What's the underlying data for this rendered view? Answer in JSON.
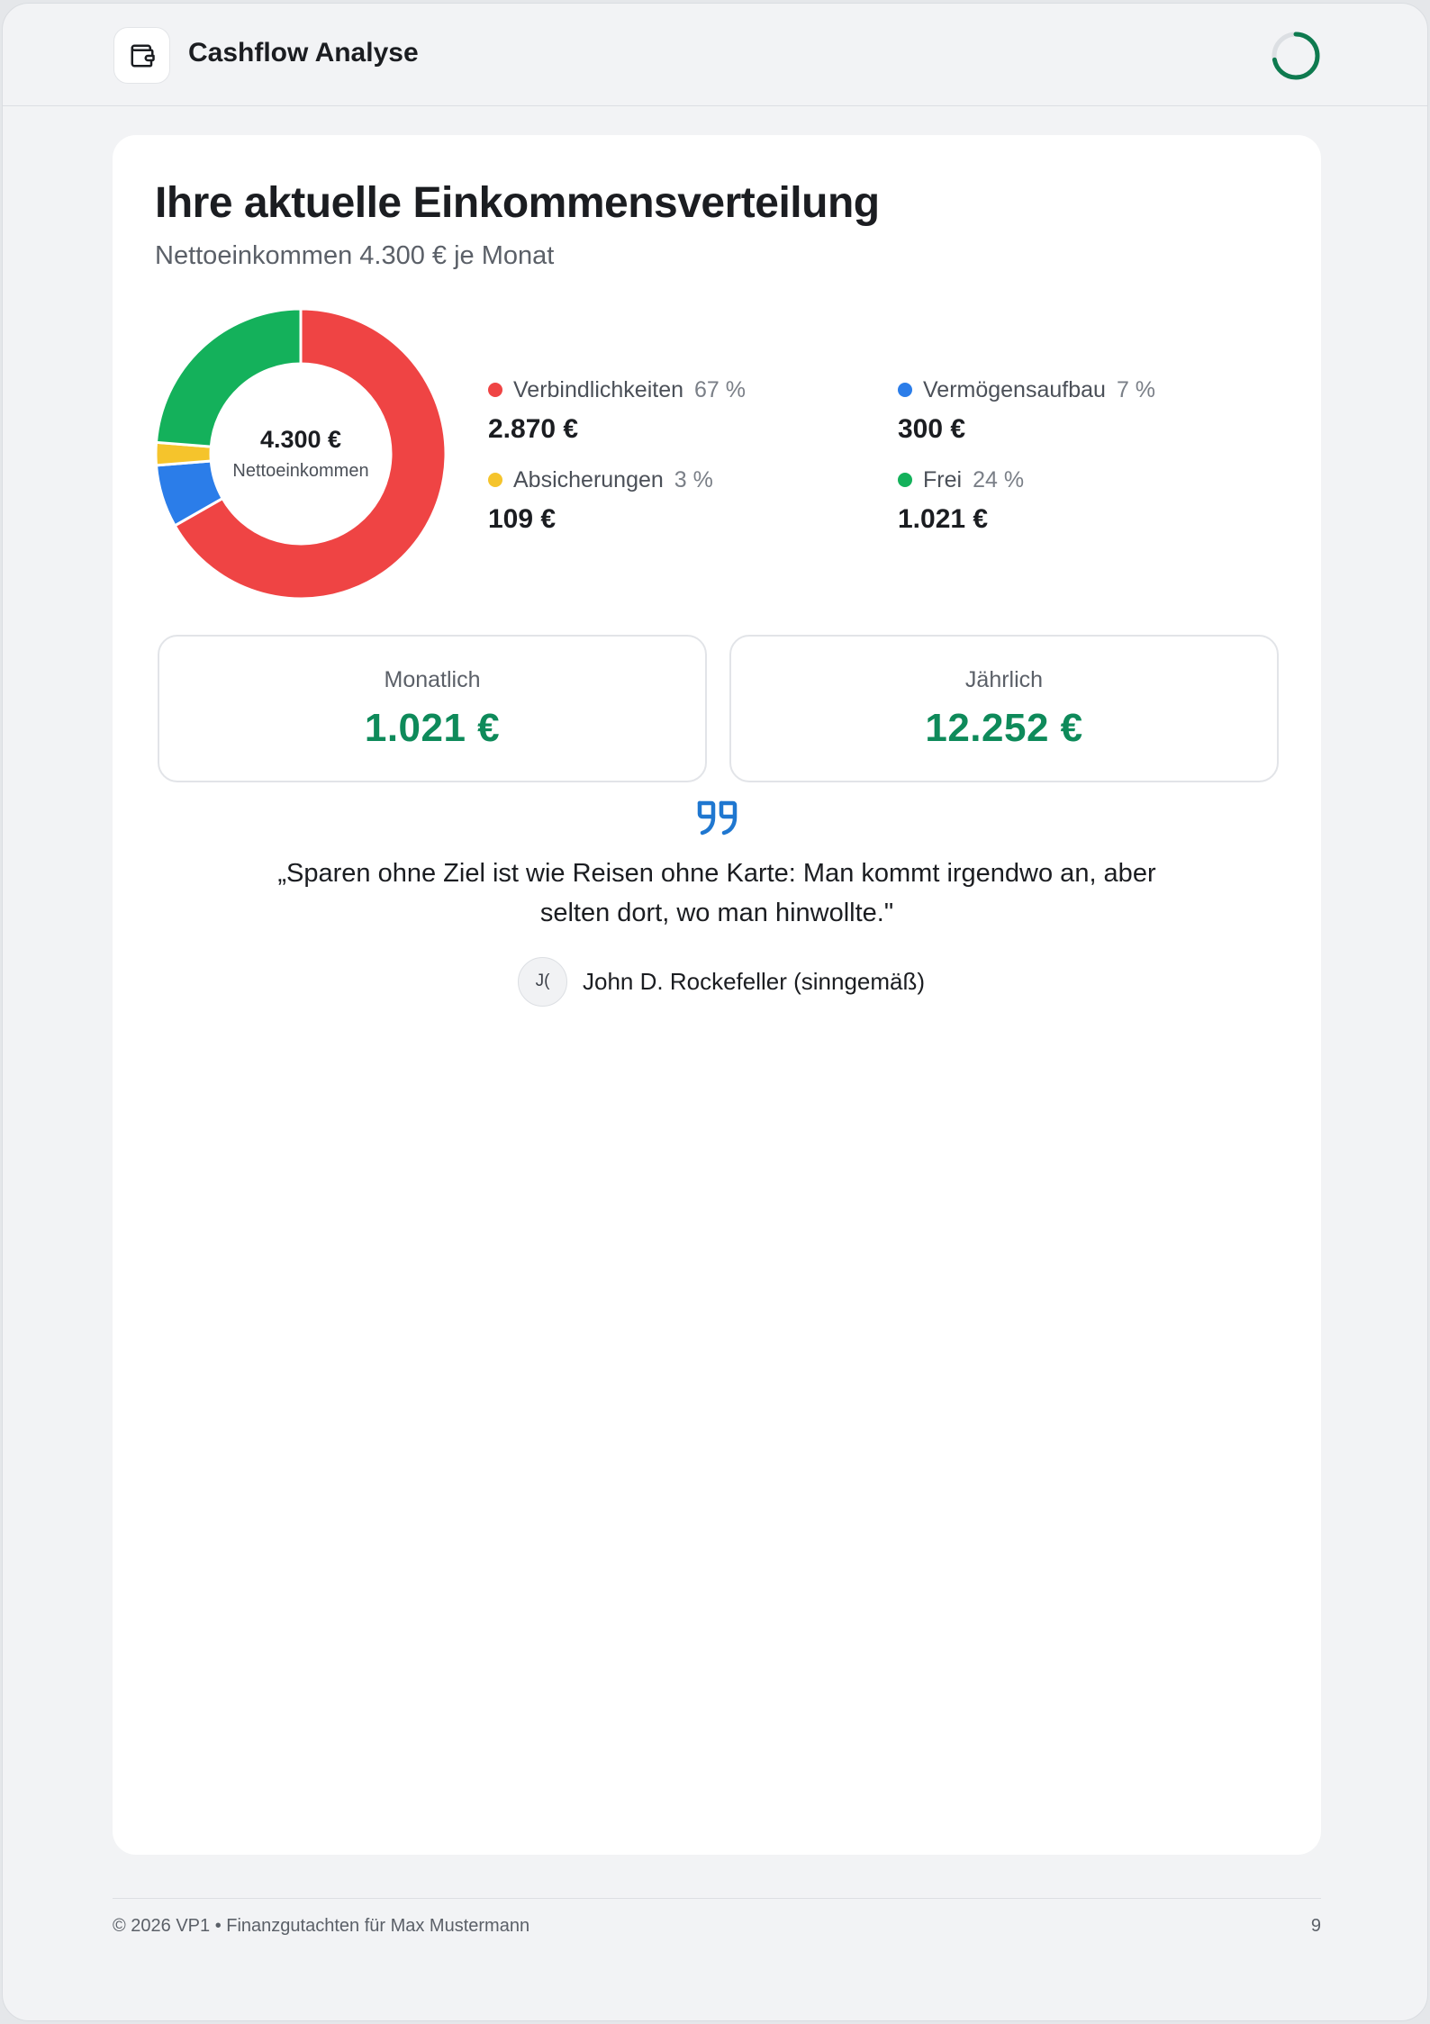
{
  "header": {
    "app_title": "Cashflow Analyse",
    "icon": "wallet-icon",
    "progress": 0.72,
    "progress_color": "#0e7a4f"
  },
  "main": {
    "title": "Ihre aktuelle Einkommensverteilung",
    "subtitle": "Nettoeinkommen 4.300 € je Monat",
    "donut_center": {
      "amount": "4.300 €",
      "label": "Nettoeinkommen"
    }
  },
  "chart_data": {
    "type": "pie",
    "total": 4300,
    "series": [
      {
        "name": "Verbindlichkeiten",
        "value": 2870,
        "value_label": "2.870 €",
        "percent_label": "67 %",
        "color": "#ef4444"
      },
      {
        "name": "Vermögensaufbau",
        "value": 300,
        "value_label": "300 €",
        "percent_label": "7 %",
        "color": "#2b7de9"
      },
      {
        "name": "Absicherungen",
        "value": 109,
        "value_label": "109 €",
        "percent_label": "3 %",
        "color": "#f5c42c"
      },
      {
        "name": "Frei",
        "value": 1021,
        "value_label": "1.021 €",
        "percent_label": "24 %",
        "color": "#14b15b"
      }
    ]
  },
  "summary": {
    "monthly": {
      "label": "Monatlich",
      "value": "1.021 €"
    },
    "yearly": {
      "label": "Jährlich",
      "value": "12.252 €"
    },
    "value_color": "#0e8a5a"
  },
  "quote": {
    "icon": "quote-icon",
    "text": "„Sparen ohne Ziel ist wie Reisen ohne Karte: Man kommt irgendwo an, aber selten dort, wo man hinwollte.\"",
    "author_initials": "J(",
    "author": "John D. Rockefeller (sinngemäß)"
  },
  "footer": {
    "left": "© 2026 VP1 • Finanzgutachten für Max Mustermann",
    "page": "9"
  }
}
